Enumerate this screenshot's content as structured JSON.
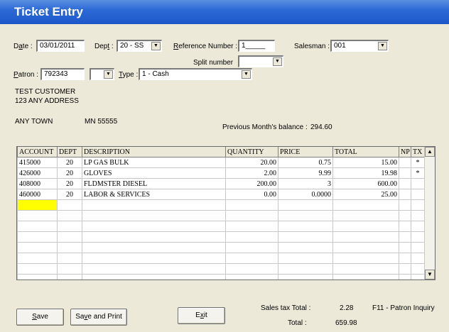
{
  "window": {
    "title": "Ticket Entry"
  },
  "header": {
    "date_label": "Date :",
    "date_value": "03/01/2011",
    "dept_label": "Dept :",
    "dept_value": "20 - SS",
    "reference_label": "Reference Number :",
    "reference_value": "1_____",
    "salesman_label": "Salesman :",
    "salesman_value": "001",
    "split_label": "Split number",
    "split_value": "",
    "patron_label": "Patron :",
    "patron_value": "792343",
    "patron_select_value": "",
    "type_label": "Type :",
    "type_value": "1 - Cash"
  },
  "customer": {
    "name": "TEST CUSTOMER",
    "address": "123 ANY ADDRESS",
    "city": "ANY TOWN",
    "state_zip": "MN 55555",
    "prev_balance_label": "Previous Month's balance :",
    "prev_balance_value": "294.60"
  },
  "table": {
    "columns": [
      "ACCOUNT",
      "DEPT",
      "DESCRIPTION",
      "QUANTITY",
      "PRICE",
      "TOTAL",
      "NP",
      "TX"
    ],
    "rows": [
      [
        "415000",
        "20",
        "LP GAS BULK",
        "20.00",
        "0.75",
        "15.00",
        "",
        "*"
      ],
      [
        "426000",
        "20",
        "GLOVES",
        "2.00",
        "9.99",
        "19.98",
        "",
        "*"
      ],
      [
        "408000",
        "20",
        "FLDMSTER DIESEL",
        "200.00",
        "3",
        "600.00",
        "",
        ""
      ],
      [
        "460000",
        "20",
        "LABOR & SERVICES",
        "0.00",
        "0.0000",
        "25.00",
        "",
        ""
      ]
    ],
    "empty_rows": 8
  },
  "totals": {
    "sales_tax_label": "Sales tax Total :",
    "sales_tax_value": "2.28",
    "total_label": "Total :",
    "total_value": "659.98",
    "hint": "F11 - Patron Inquiry"
  },
  "buttons": {
    "save": "Save",
    "save_print": "Save and Print",
    "exit": "Exit"
  },
  "icons": {
    "dropdown": "chevron-down-icon",
    "scroll_up": "scroll-up-icon",
    "scroll_down": "scroll-down-icon"
  }
}
